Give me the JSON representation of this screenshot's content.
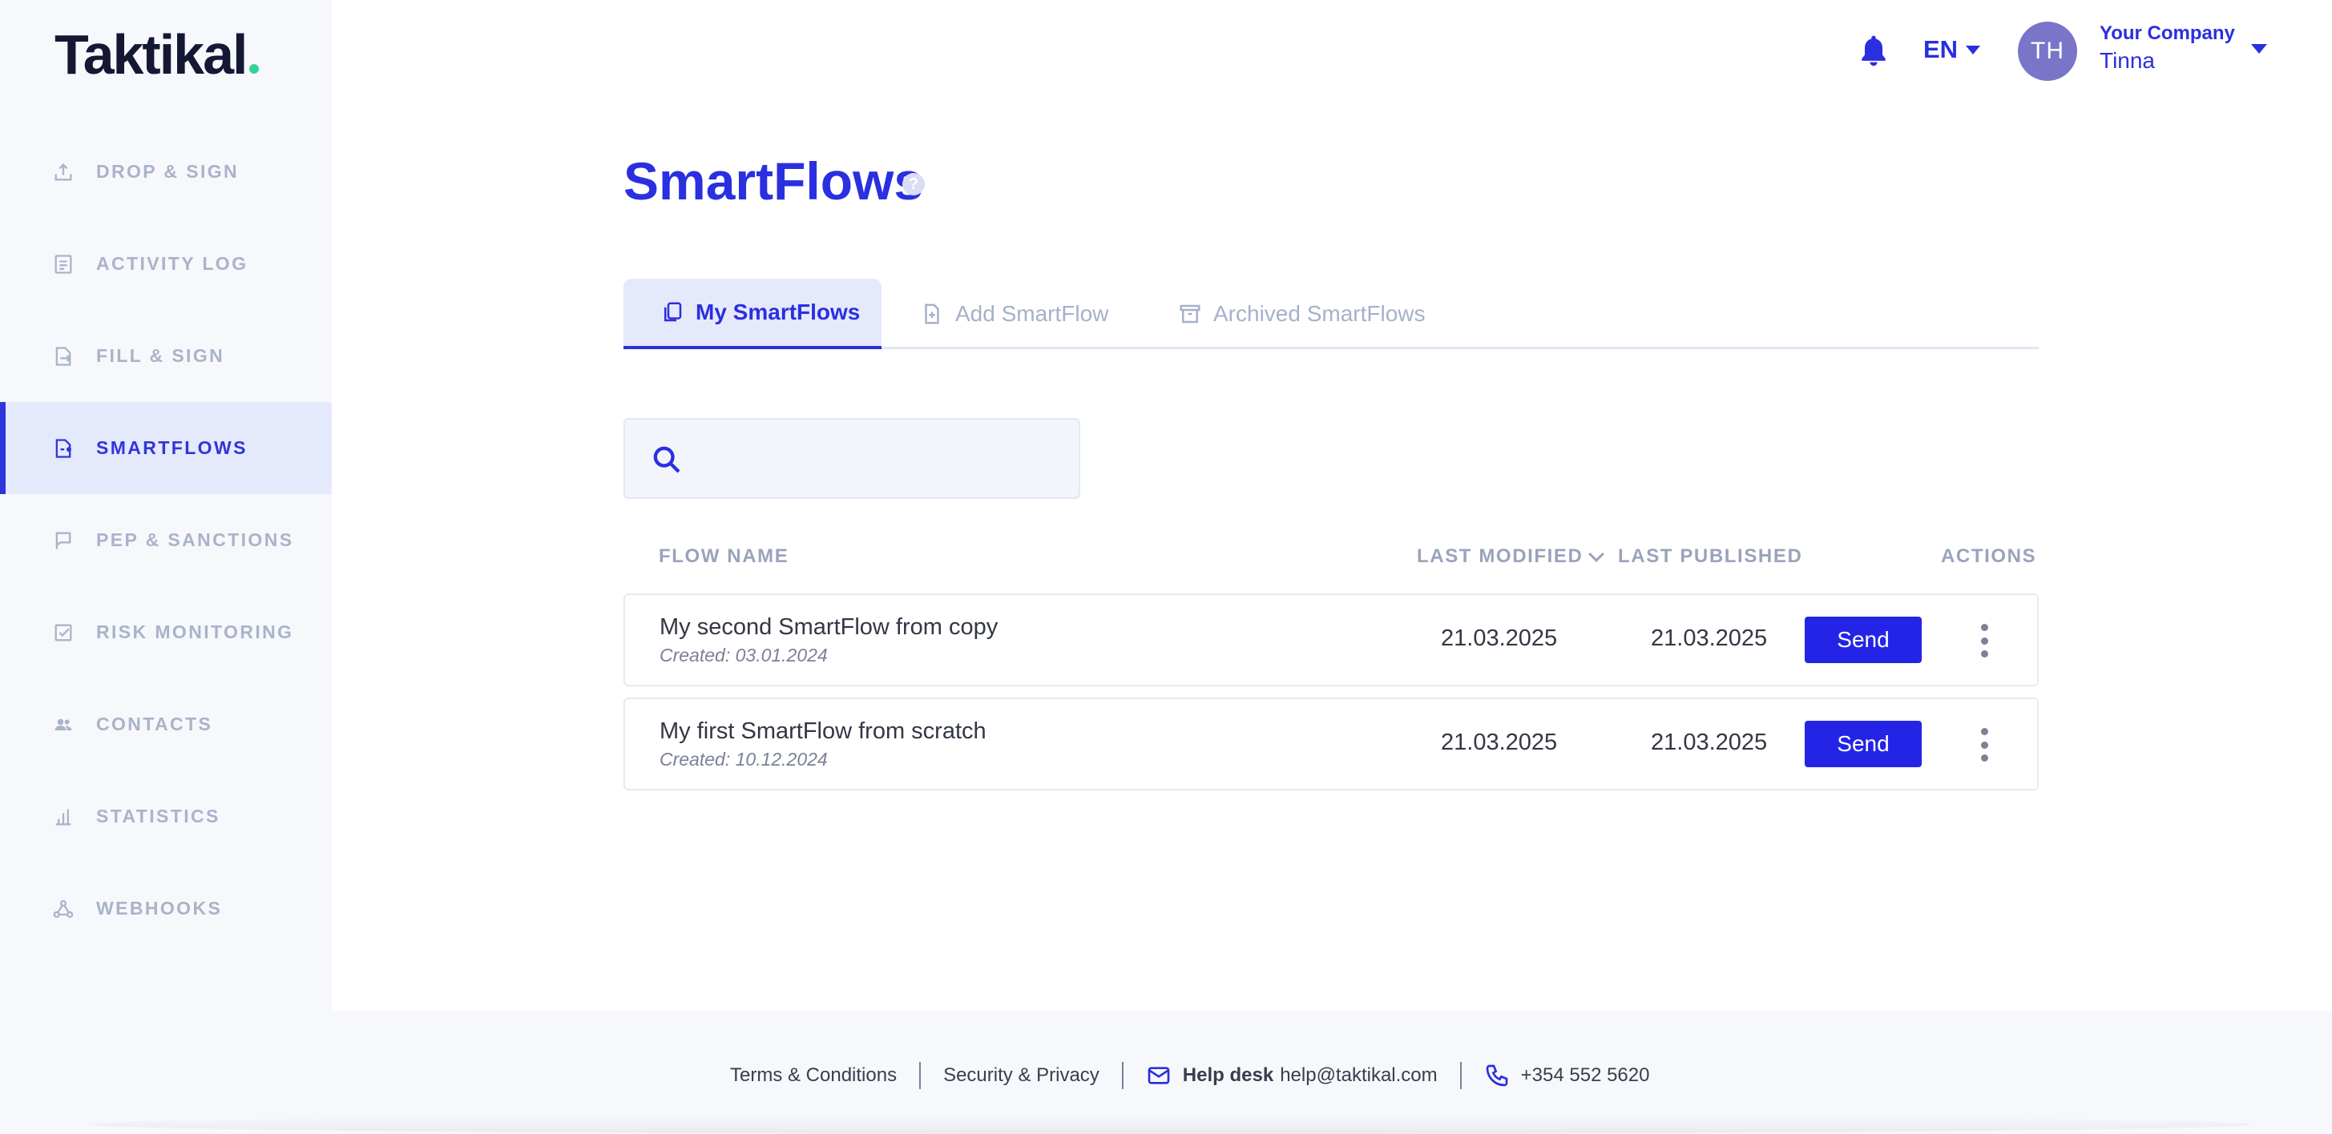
{
  "brand": {
    "logo_text": "Taktikal",
    "accent_color": "#2a2fe0",
    "logo_dot_color": "#34d399"
  },
  "sidebar": {
    "items": [
      {
        "label": "DROP & SIGN",
        "icon": "upload-icon",
        "active": false
      },
      {
        "label": "ACTIVITY LOG",
        "icon": "document-list-icon",
        "active": false
      },
      {
        "label": "FILL & SIGN",
        "icon": "document-pen-icon",
        "active": false
      },
      {
        "label": "SMARTFLOWS",
        "icon": "document-flow-icon",
        "active": true
      },
      {
        "label": "PEP & SANCTIONS",
        "icon": "flag-icon",
        "active": false
      },
      {
        "label": "RISK MONITORING",
        "icon": "checklist-icon",
        "active": false
      },
      {
        "label": "CONTACTS",
        "icon": "people-icon",
        "active": false
      },
      {
        "label": "STATISTICS",
        "icon": "bar-chart-icon",
        "active": false
      },
      {
        "label": "WEBHOOKS",
        "icon": "webhook-icon",
        "active": false
      }
    ]
  },
  "header": {
    "language": "EN",
    "avatar_initials": "TH",
    "company_name": "Your Company",
    "user_name": "Tinna"
  },
  "page": {
    "title": "SmartFlows",
    "help_glyph": "?"
  },
  "tabs": [
    {
      "label": "My SmartFlows",
      "icon": "copy-icon",
      "active": true
    },
    {
      "label": "Add SmartFlow",
      "icon": "add-file-icon",
      "active": false
    },
    {
      "label": "Archived SmartFlows",
      "icon": "archive-icon",
      "active": false
    }
  ],
  "search": {
    "value": "",
    "placeholder": ""
  },
  "table": {
    "columns": {
      "flow_name": "FLOW NAME",
      "last_modified": "LAST MODIFIED",
      "last_published": "LAST PUBLISHED",
      "actions": "ACTIONS"
    },
    "sort": {
      "column": "last_modified",
      "direction": "desc"
    },
    "rows": [
      {
        "name": "My second SmartFlow from copy",
        "created": "Created: 03.01.2024",
        "last_modified": "21.03.2025",
        "last_published": "21.03.2025",
        "action_label": "Send"
      },
      {
        "name": "My first SmartFlow from scratch",
        "created": "Created: 10.12.2024",
        "last_modified": "21.03.2025",
        "last_published": "21.03.2025",
        "action_label": "Send"
      }
    ]
  },
  "footer": {
    "terms": "Terms & Conditions",
    "security": "Security & Privacy",
    "helpdesk_label": "Help desk",
    "helpdesk_email": "help@taktikal.com",
    "phone": "+354 552 5620"
  }
}
